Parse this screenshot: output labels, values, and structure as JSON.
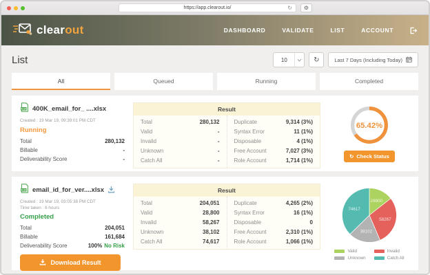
{
  "browser": {
    "url": "https://app.clearout.io/"
  },
  "header": {
    "logo": {
      "text_primary": "clear",
      "text_accent": "out"
    },
    "nav": [
      {
        "label": "DASHBOARD"
      },
      {
        "label": "VALIDATE"
      },
      {
        "label": "LIST"
      },
      {
        "label": "ACCOUNT"
      }
    ]
  },
  "page": {
    "title": "List",
    "per_page": "10",
    "date_range": "Last 7 Days (Including Today)",
    "tabs": [
      {
        "label": "All"
      },
      {
        "label": "Queued"
      },
      {
        "label": "Running"
      },
      {
        "label": "Completed"
      }
    ]
  },
  "items": [
    {
      "filename": "400K_email_for_ ....xlsx",
      "created": "Created : 19 Mar 19, 09:39:01 PM CDT",
      "status": "Running",
      "status_color": "#f5993d",
      "meta": [
        {
          "label": "Total",
          "value": "280,132",
          "extra": ""
        },
        {
          "label": "Billable",
          "value": "-",
          "extra": ""
        },
        {
          "label": "Deliverability Score",
          "value": "-",
          "extra": ""
        }
      ],
      "result": {
        "title": "Result",
        "left": [
          {
            "label": "Total",
            "value": "280,132"
          },
          {
            "label": "Valid",
            "value": "-"
          },
          {
            "label": "Invalid",
            "value": "-"
          },
          {
            "label": "Unknown",
            "value": "-"
          },
          {
            "label": "Catch All",
            "value": "-"
          }
        ],
        "right": [
          {
            "label": "Duplicate",
            "value": "9,314 (3%)"
          },
          {
            "label": "Syntax Error",
            "value": "11 (1%)"
          },
          {
            "label": "Disposable",
            "value": "4 (1%)"
          },
          {
            "label": "Free Account",
            "value": "7,027 (3%)"
          },
          {
            "label": "Role Account",
            "value": "1,714 (1%)"
          }
        ]
      },
      "action_label": "Check Status"
    },
    {
      "filename": "email_id_for_ver....xlsx",
      "created": "Created : 19 Mar 19, 03:05:38 PM CDT",
      "time_taken": "Time taken : 6 hours",
      "status": "Completed",
      "status_color": "#35a048",
      "meta": [
        {
          "label": "Total",
          "value": "204,051",
          "extra": ""
        },
        {
          "label": "Billable",
          "value": "161,684",
          "extra": ""
        },
        {
          "label": "Deliverability Score",
          "value": "100%",
          "extra": "No Risk"
        }
      ],
      "result": {
        "title": "Result",
        "left": [
          {
            "label": "Total",
            "value": "204,051"
          },
          {
            "label": "Valid",
            "value": "28,800"
          },
          {
            "label": "Invalid",
            "value": "58,267"
          },
          {
            "label": "Unknown",
            "value": "38,102"
          },
          {
            "label": "Catch All",
            "value": "74,617"
          }
        ],
        "right": [
          {
            "label": "Duplicate",
            "value": "4,265 (2%)"
          },
          {
            "label": "Syntax Error",
            "value": "16 (1%)"
          },
          {
            "label": "Disposable",
            "value": "0"
          },
          {
            "label": "Free Account",
            "value": "2,310 (1%)"
          },
          {
            "label": "Role Account",
            "value": "1,066 (1%)"
          }
        ]
      },
      "action_label": "Download Result"
    }
  ],
  "chart_data": [
    {
      "type": "donut",
      "value": 65.42,
      "label": "65.42%",
      "color": "#f0923b",
      "track_color": "#d5d5d5"
    },
    {
      "type": "pie",
      "categories": [
        "Valid",
        "Invalid",
        "Unknown",
        "Catch All"
      ],
      "values": [
        28800,
        58267,
        38102,
        74617
      ],
      "labels": [
        "28800",
        "58267",
        "38102",
        "74617"
      ],
      "colors": [
        "#acd35f",
        "#e5615c",
        "#b3b3b3",
        "#55bab0"
      ],
      "legend_position": "bottom"
    }
  ],
  "colors": {
    "accent_orange": "#f2952d",
    "tab_underline": "#f0953c",
    "running": "#f5993d",
    "completed": "#35a048",
    "download_icon_blue": "#6fa0c3",
    "xlsx_green": "#44a248"
  }
}
